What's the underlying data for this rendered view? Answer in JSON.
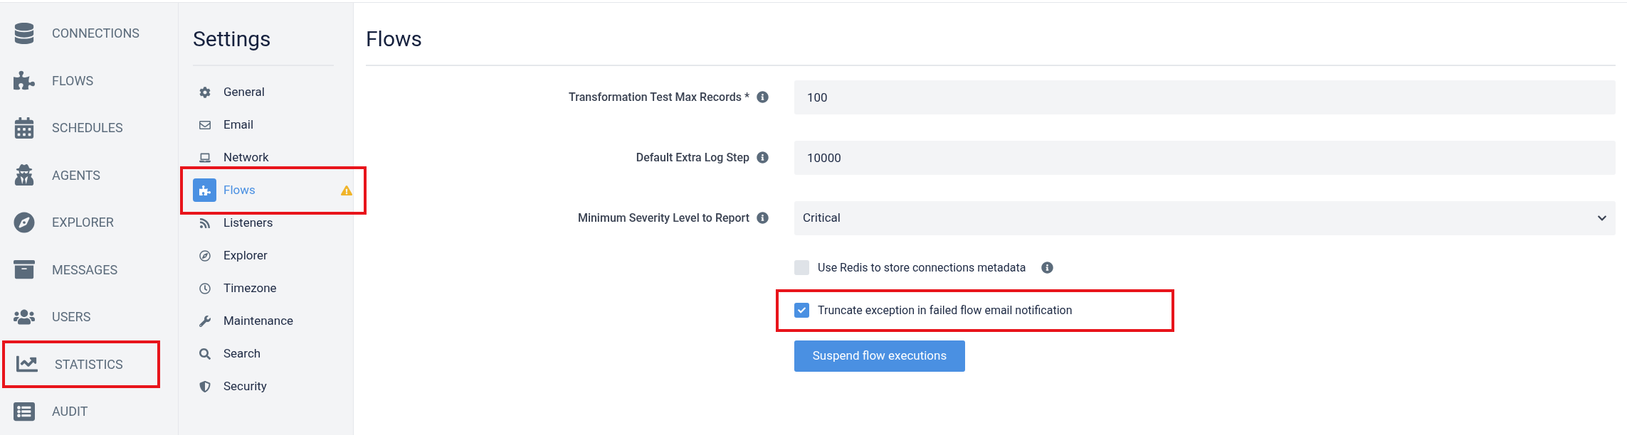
{
  "nav": [
    {
      "label": "CONNECTIONS",
      "highlighted": false
    },
    {
      "label": "FLOWS",
      "highlighted": false
    },
    {
      "label": "SCHEDULES",
      "highlighted": false
    },
    {
      "label": "AGENTS",
      "highlighted": false
    },
    {
      "label": "EXPLORER",
      "highlighted": false
    },
    {
      "label": "MESSAGES",
      "highlighted": false
    },
    {
      "label": "USERS",
      "highlighted": false
    },
    {
      "label": "STATISTICS",
      "highlighted": true
    },
    {
      "label": "AUDIT",
      "highlighted": false
    }
  ],
  "settings": {
    "title": "Settings",
    "items": [
      {
        "label": "General",
        "selected": false,
        "warning": false,
        "highlighted": false
      },
      {
        "label": "Email",
        "selected": false,
        "warning": false,
        "highlighted": false
      },
      {
        "label": "Network",
        "selected": false,
        "warning": false,
        "highlighted": false
      },
      {
        "label": "Flows",
        "selected": true,
        "warning": true,
        "highlighted": true
      },
      {
        "label": "Listeners",
        "selected": false,
        "warning": false,
        "highlighted": false
      },
      {
        "label": "Explorer",
        "selected": false,
        "warning": false,
        "highlighted": false
      },
      {
        "label": "Timezone",
        "selected": false,
        "warning": false,
        "highlighted": false
      },
      {
        "label": "Maintenance",
        "selected": false,
        "warning": false,
        "highlighted": false
      },
      {
        "label": "Search",
        "selected": false,
        "warning": false,
        "highlighted": false
      },
      {
        "label": "Security",
        "selected": false,
        "warning": false,
        "highlighted": false
      }
    ]
  },
  "page": {
    "title": "Flows",
    "fields": [
      {
        "kind": "input",
        "label": "Transformation Test Max Records *",
        "value": "100"
      },
      {
        "kind": "input",
        "label": "Default Extra Log Step",
        "value": "10000"
      },
      {
        "kind": "select",
        "label": "Minimum Severity Level to Report",
        "value": "Critical"
      }
    ],
    "checkboxes": [
      {
        "label": "Use Redis to store connections metadata",
        "checked": false,
        "info": true,
        "highlighted": false
      },
      {
        "label": "Truncate exception in failed flow email notification",
        "checked": true,
        "info": false,
        "highlighted": true
      }
    ],
    "button": "Suspend flow executions"
  }
}
